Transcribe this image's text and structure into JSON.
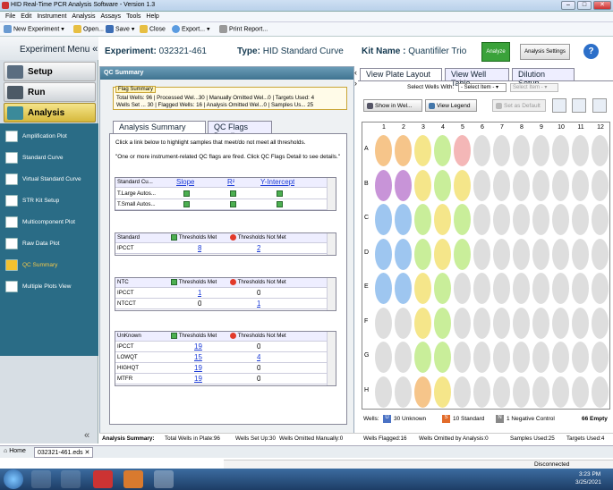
{
  "window": {
    "title": "HID Real-Time PCR Analysis Software - Version 1.3"
  },
  "menu": [
    "File",
    "Edit",
    "Instrument",
    "Analysis",
    "Assays",
    "Tools",
    "Help"
  ],
  "toolbar": {
    "new_experiment": "New Experiment",
    "open": "Open...",
    "save": "Save",
    "close": "Close",
    "export": "Export...",
    "print": "Print Report..."
  },
  "left": {
    "header": "Experiment Menu",
    "nav": [
      "Setup",
      "Run",
      "Analysis"
    ],
    "sub": [
      "Amplification Plot",
      "Standard Curve",
      "Virtual Standard Curve",
      "STR Kit Setup",
      "Multicomponent Plot",
      "Raw Data Plot",
      "QC Summary",
      "Multiple Plots View"
    ]
  },
  "header": {
    "exp_label": "Experiment:",
    "exp_value": "032321-461",
    "type_label": "Type:",
    "type_value": "HID Standard Curve",
    "kit_label": "Kit Name :",
    "kit_value": "Quantifiler Trio",
    "analyze": "Analyze",
    "analysis_settings": "Analysis Settings",
    "help": "?"
  },
  "qc": {
    "title": "QC Summary",
    "flag_label": "Flag Summary",
    "flag_line1": "Total Wells:  96 | Processed Wel...30 | Manually Omitted Wel...0 | Targets Used:  4",
    "flag_line2": "Wells Set ...  30 | Flagged Wells:  16 | Analysis Omitted Wel...0 | Samples Us...  25",
    "tabs": [
      "Analysis Summary",
      "QC Flags Detail"
    ],
    "intro1": "Click a link below to highlight samples that meet/do not meet all thresholds.",
    "intro2": "\"One or more instrument-related QC flags are fired.  Click QC Flags Detail to see details.\"",
    "stdcurve": {
      "headers": [
        "Standard Cu...",
        "Slope",
        "R²",
        "Y-Intercept"
      ],
      "rows": [
        "T.Large Autos...",
        "T.Small Autos..."
      ]
    },
    "standard": {
      "headers": [
        "Standard",
        "Thresholds Met",
        "Thresholds Not Met"
      ],
      "rows": [
        [
          "IPCCT",
          "8",
          "2"
        ]
      ]
    },
    "ntc": {
      "headers": [
        "NTC",
        "Thresholds Met",
        "Thresholds Not Met"
      ],
      "rows": [
        [
          "IPCCT",
          "1",
          "0"
        ],
        [
          "NTCCT",
          "0",
          "1"
        ]
      ]
    },
    "unknown": {
      "headers": [
        "UnKnown",
        "Thresholds Met",
        "Thresholds Not Met"
      ],
      "rows": [
        [
          "IPCCT",
          "19",
          "0"
        ],
        [
          "LOWQT",
          "15",
          "4"
        ],
        [
          "HIGHQT",
          "19",
          "0"
        ],
        [
          "MTFR",
          "19",
          "0"
        ]
      ]
    }
  },
  "right": {
    "tabs": [
      "View Plate Layout",
      "View Well Table",
      "Dilution Setup"
    ],
    "select_label": "Select Wells With:",
    "select_item": "- Select Item -",
    "select_item2": "Select Item -",
    "show_in_well": "Show in Wel...",
    "view_legend": "View Legend",
    "set_default": "Set as Default",
    "cols": [
      "1",
      "2",
      "3",
      "4",
      "5",
      "6",
      "7",
      "8",
      "9",
      "10",
      "11",
      "12"
    ],
    "rows": [
      "A",
      "B",
      "C",
      "D",
      "E",
      "F",
      "G",
      "H"
    ],
    "legend": {
      "wells": "Wells:",
      "unknown": "30 Unknown",
      "standard": "10 Standard",
      "neg": "1 Negative Control",
      "empty": "66 Empty"
    }
  },
  "status": {
    "label": "Analysis Summary:",
    "items": [
      "Total Wells in Plate:96",
      "Wells Set Up:30",
      "Wells Omitted Manually:0",
      "Wells Flagged:16",
      "Wells Omitted by Analysis:0",
      "Samples Used:25",
      "Targets Used:4"
    ]
  },
  "tabstrip": {
    "home": "Home",
    "file": "032321-461.eds"
  },
  "taskbar": {
    "connected": "Disconnected",
    "time": "3:23 PM",
    "date": "3/25/2021"
  }
}
